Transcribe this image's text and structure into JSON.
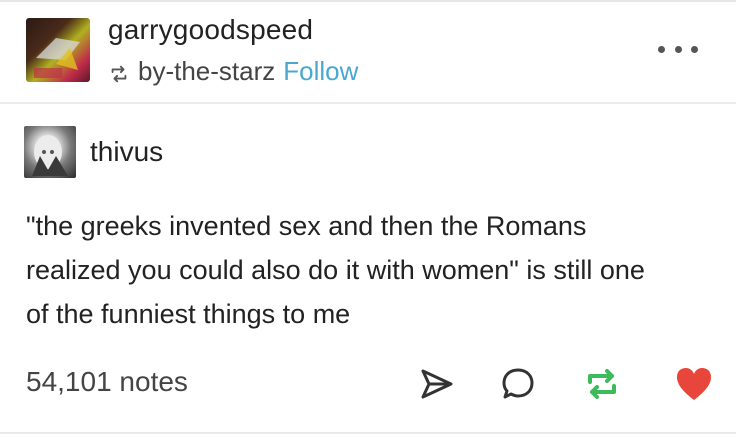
{
  "header": {
    "username": "garrygoodspeed",
    "reblog_source": "by-the-starz",
    "follow_label": "Follow"
  },
  "post": {
    "author": "thivus",
    "lines": [
      "\"the greeks invented sex and then the Romans",
      "realized you could also do it with women\" is still one",
      "of the funniest things to me"
    ]
  },
  "footer": {
    "notes": "54,101 notes"
  },
  "icons": {
    "reblog_small": "reblog-icon",
    "share": "paper-plane-icon",
    "reply": "speech-bubble-icon",
    "reblog": "reblog-icon",
    "like": "heart-icon"
  },
  "colors": {
    "follow": "#4aa8d0",
    "reblog": "#3dba5a",
    "like": "#e8463a"
  }
}
